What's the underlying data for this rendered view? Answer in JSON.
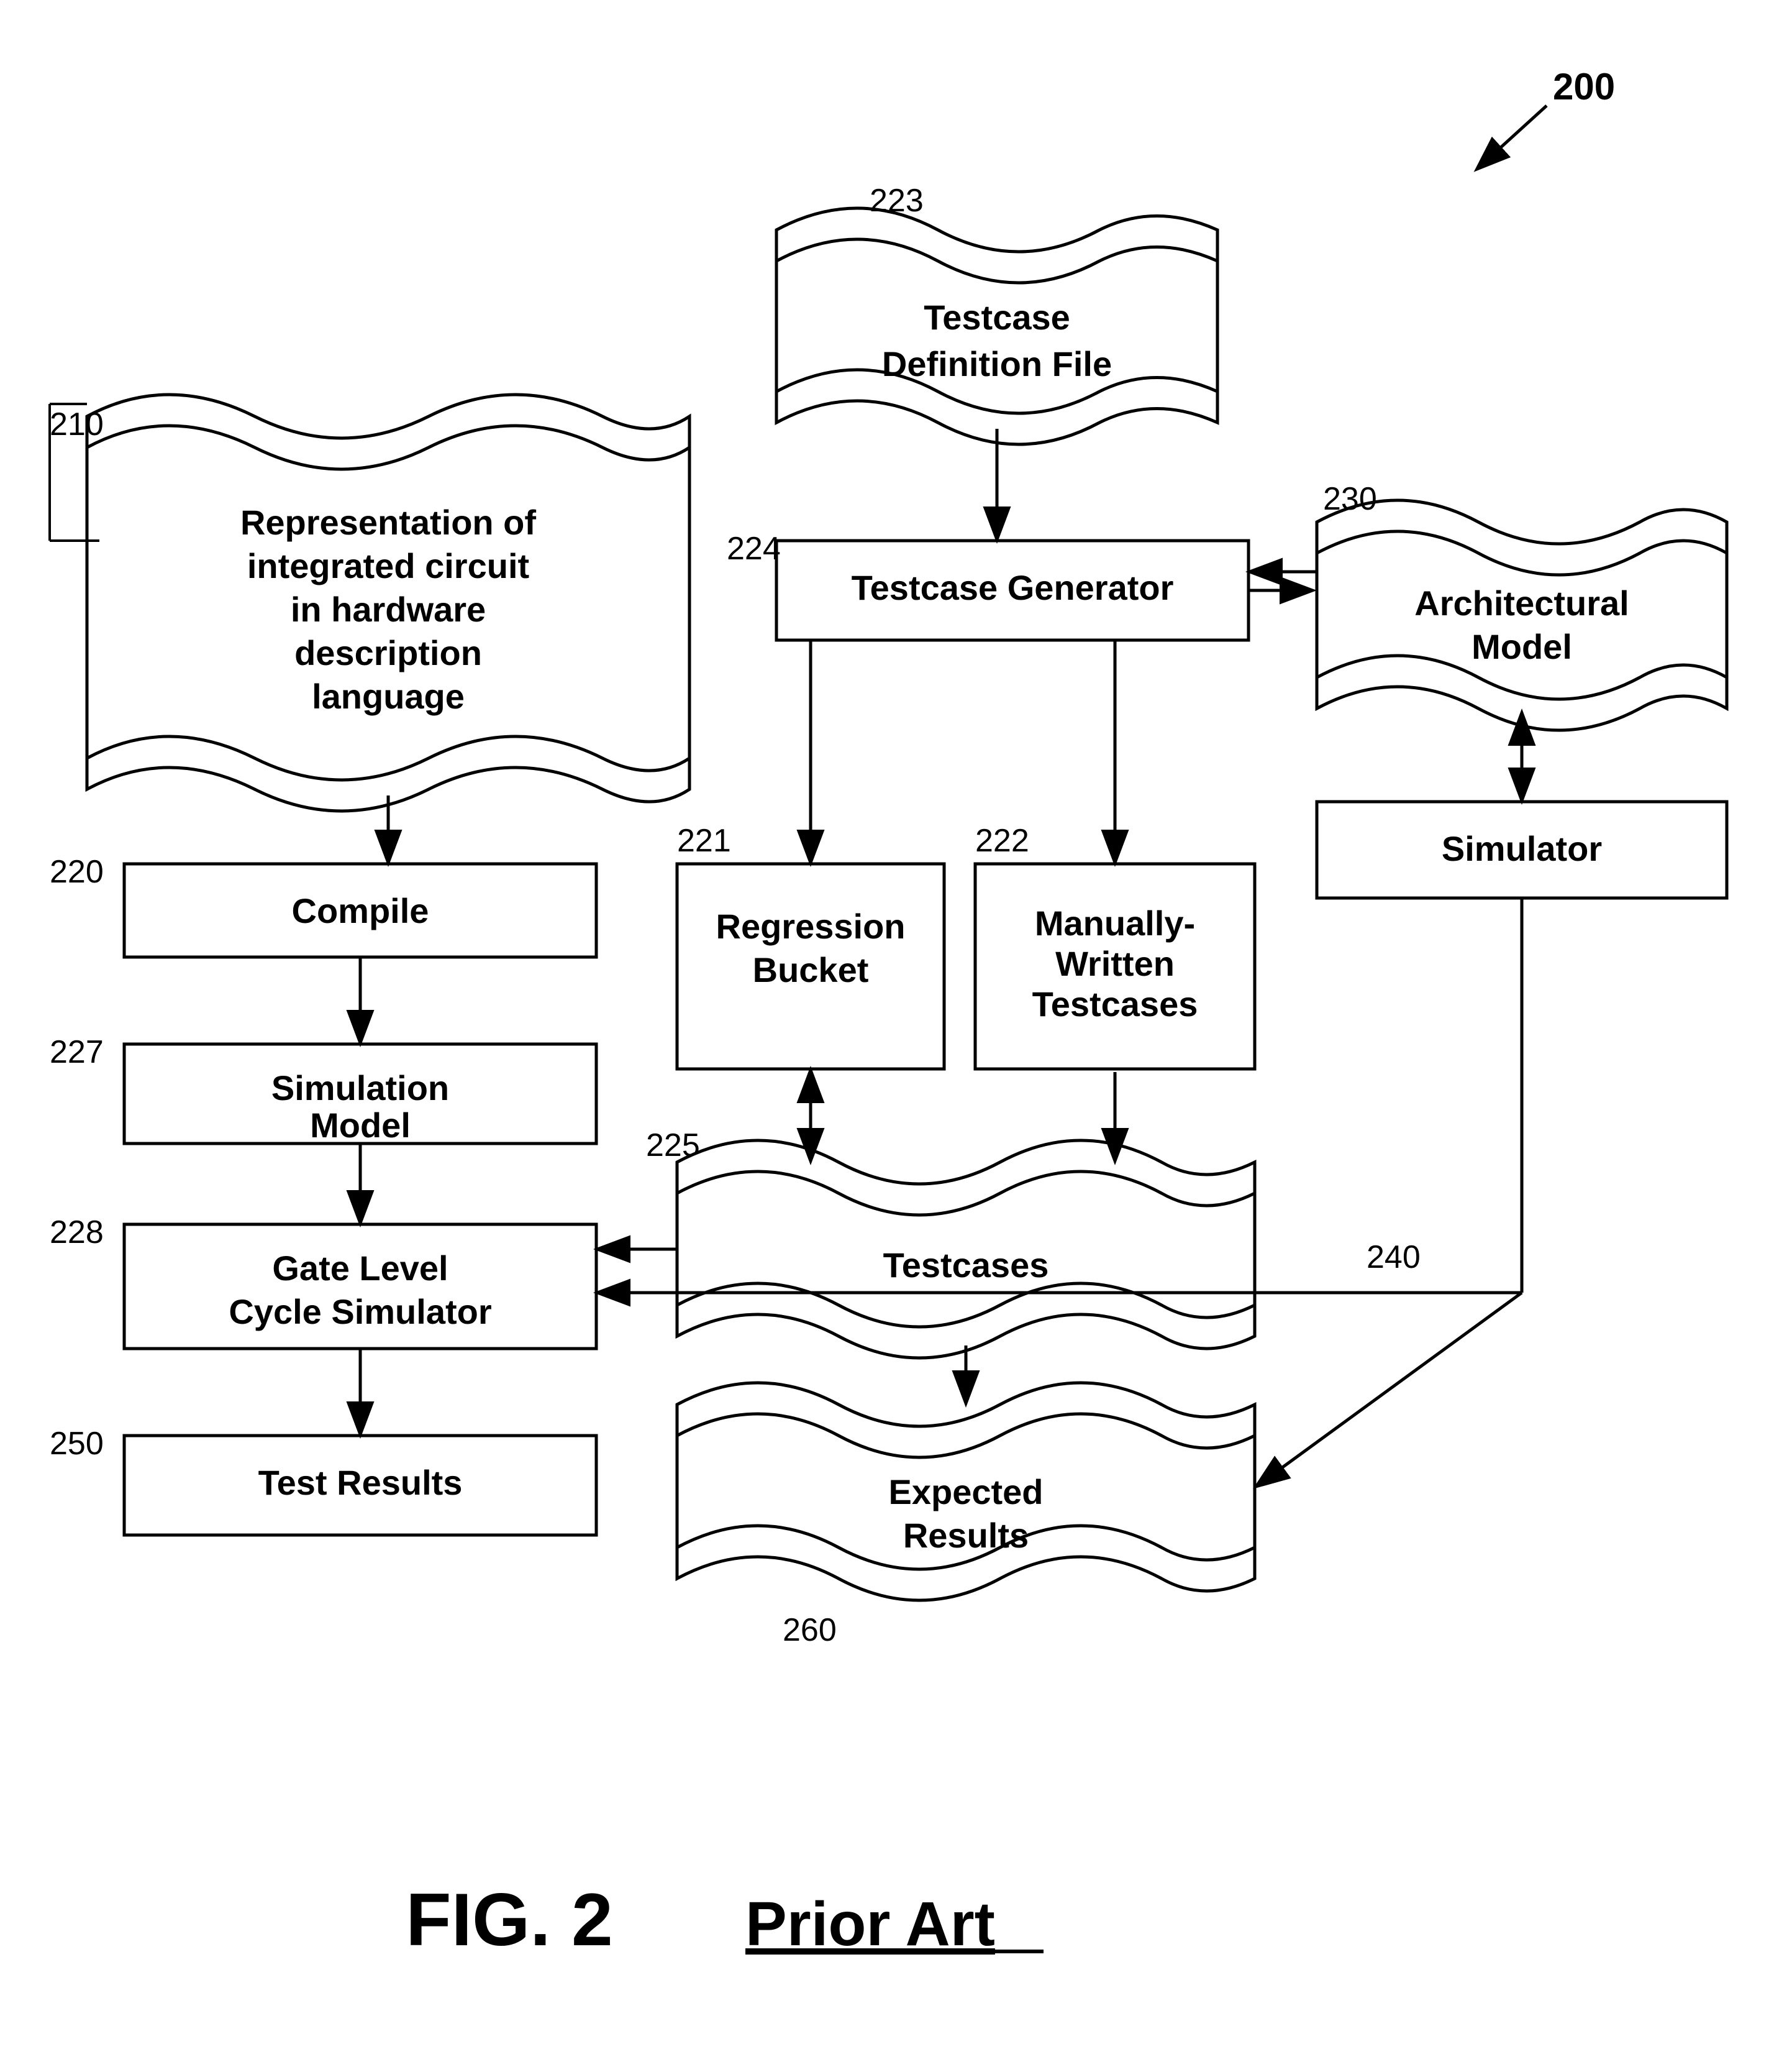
{
  "figure": {
    "number": "200",
    "caption": "FIG. 2",
    "prior_art": "Prior Art"
  },
  "nodes": {
    "n210": {
      "id": "210",
      "label": "Representation of integrated circuit in hardware description language",
      "type": "scroll"
    },
    "n220": {
      "id": "220",
      "label": "Compile",
      "type": "rect"
    },
    "n223": {
      "id": "223",
      "label": "Testcase Definition File",
      "type": "scroll"
    },
    "n224": {
      "id": "224",
      "label": "Testcase Generator",
      "type": "rect"
    },
    "n230": {
      "id": "230",
      "label": "Architectural Model",
      "type": "scroll"
    },
    "n227": {
      "id": "227",
      "label": "Simulation Model",
      "type": "rect"
    },
    "n221": {
      "id": "221",
      "label": "Regression Bucket",
      "type": "rect"
    },
    "n222": {
      "id": "222",
      "label": "Manually-Written Testcases",
      "type": "rect"
    },
    "n_sim": {
      "id": "",
      "label": "Simulator",
      "type": "rect"
    },
    "n228": {
      "id": "228",
      "label": "Gate Level Cycle Simulator",
      "type": "rect"
    },
    "n225": {
      "id": "225",
      "label": "Testcases",
      "type": "scroll"
    },
    "n240": {
      "id": "240",
      "label": "",
      "type": "label"
    },
    "n250": {
      "id": "250",
      "label": "Test Results",
      "type": "rect"
    },
    "n260": {
      "id": "260",
      "label": "Expected Results",
      "type": "scroll"
    }
  }
}
